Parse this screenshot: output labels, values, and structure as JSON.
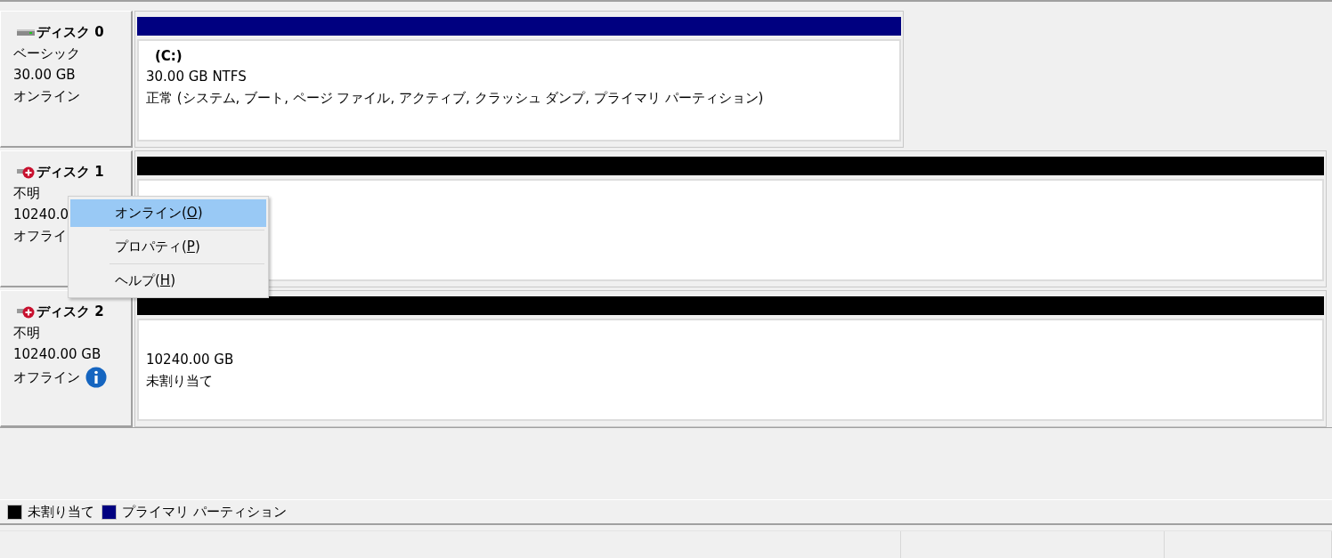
{
  "disks": [
    {
      "name": "ディスク 0",
      "kind": "online",
      "type": "ベーシック",
      "size": "30.00 GB",
      "status": "オンライン",
      "info_icon": false,
      "partitions": [
        {
          "kind": "primary",
          "title": "(C:)",
          "lines": [
            "30.00 GB NTFS",
            "正常 (システム, ブート, ページ ファイル, アクティブ, クラッシュ ダンプ, プライマリ パーティション)"
          ]
        }
      ]
    },
    {
      "name": "ディスク 1",
      "kind": "offline",
      "type": "不明",
      "size": "10240.0",
      "status": "オフライ",
      "info_icon": false,
      "partitions": [
        {
          "kind": "unallocated"
        }
      ]
    },
    {
      "name": "ディスク 2",
      "kind": "offline",
      "type": "不明",
      "size": "10240.00 GB",
      "status": "オフライン",
      "info_icon": true,
      "partitions": [
        {
          "kind": "unallocated",
          "lines": [
            "10240.00 GB",
            "未割り当て"
          ]
        }
      ]
    }
  ],
  "context_menu": {
    "items": [
      {
        "text_before": "オンライン(",
        "access_key": "O",
        "text_after": ")",
        "selected": true
      },
      {
        "text_before": "プロパティ(",
        "access_key": "P",
        "text_after": ")",
        "selected": false
      },
      {
        "text_before": "ヘルプ(",
        "access_key": "H",
        "text_after": ")",
        "selected": false
      }
    ]
  },
  "legend": [
    {
      "label": "未割り当て",
      "color": "#000000"
    },
    {
      "label": "プライマリ パーティション",
      "color": "#000080"
    }
  ]
}
